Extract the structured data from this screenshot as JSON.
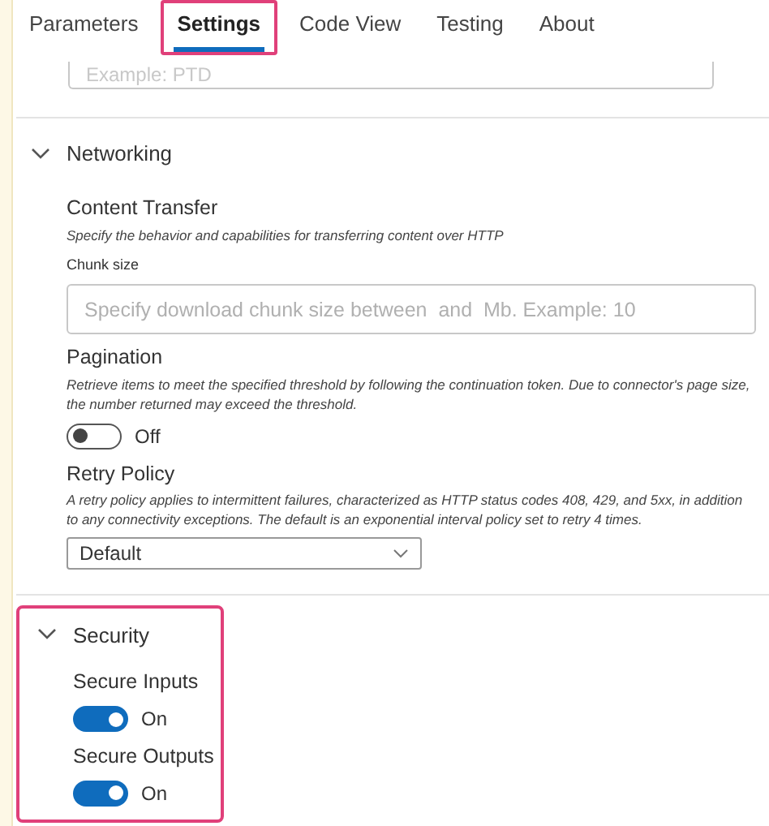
{
  "tabs": [
    {
      "label": "Parameters",
      "selected": false,
      "highlighted": false
    },
    {
      "label": "Settings",
      "selected": true,
      "highlighted": true
    },
    {
      "label": "Code View",
      "selected": false,
      "highlighted": false
    },
    {
      "label": "Testing",
      "selected": false,
      "highlighted": false
    },
    {
      "label": "About",
      "selected": false,
      "highlighted": false
    }
  ],
  "top_field": {
    "placeholder": "Example: PTD"
  },
  "sections": [
    {
      "title": "Networking",
      "expanded": true,
      "highlighted": false,
      "settings": [
        {
          "kind": "field",
          "label": "Content Transfer",
          "description": "Specify the behavior and capabilities for transferring content over HTTP",
          "sublabel": "Chunk size",
          "placeholder": "Specify download chunk size between  and  Mb. Example: 10"
        },
        {
          "kind": "toggle",
          "label": "Pagination",
          "description": "Retrieve items to meet the specified threshold by following the continuation token. Due to connector's page size, the number returned may exceed the threshold.",
          "on": false,
          "state_label": "Off"
        },
        {
          "kind": "dropdown",
          "label": "Retry Policy",
          "description": "A retry policy applies to intermittent failures, characterized as HTTP status codes 408, 429, and 5xx, in addition to any connectivity exceptions. The default is an exponential interval policy set to retry 4 times.",
          "value": "Default"
        }
      ]
    },
    {
      "title": "Security",
      "expanded": true,
      "highlighted": true,
      "settings": [
        {
          "kind": "toggle",
          "label": "Secure Inputs",
          "on": true,
          "state_label": "On"
        },
        {
          "kind": "toggle",
          "label": "Secure Outputs",
          "on": true,
          "state_label": "On"
        }
      ]
    }
  ]
}
